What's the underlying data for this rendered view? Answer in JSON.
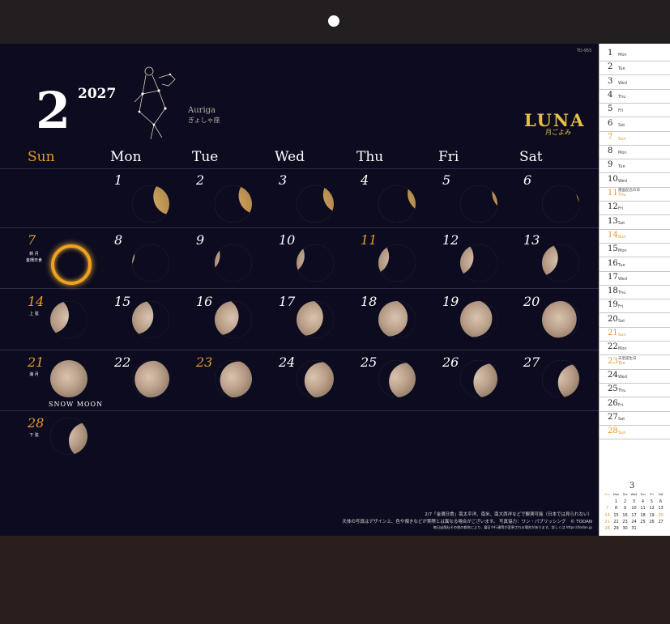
{
  "month": "2",
  "year": "2027",
  "code": "TD-955",
  "constellation": {
    "name": "Auriga",
    "jp": "ぎょしゃ座"
  },
  "brand": {
    "title": "LUNA",
    "subtitle": "月ごよみ"
  },
  "weekdays": [
    "Sun",
    "Mon",
    "Tue",
    "Wed",
    "Thu",
    "Fri",
    "Sat"
  ],
  "weeks": [
    [
      null,
      "1",
      "2",
      "3",
      "4",
      "5",
      "6"
    ],
    [
      "7",
      "8",
      "9",
      "10",
      "11",
      "12",
      "13"
    ],
    [
      "14",
      "15",
      "16",
      "17",
      "18",
      "19",
      "20"
    ],
    [
      "21",
      "22",
      "23",
      "24",
      "25",
      "26",
      "27"
    ],
    [
      "28",
      null,
      null,
      null,
      null,
      null,
      null
    ]
  ],
  "holidays": [
    "11",
    "23"
  ],
  "notes": {
    "7a": "新 月",
    "7b": "金環日食",
    "14": "上 弦",
    "21": "満 月",
    "28": "下 弦"
  },
  "snow_moon": "SNOW MOON",
  "footnote": {
    "line1": "2/7「金環日食」南太平洋、南米、南大西洋などで観測可能（日本では見られない）",
    "line2": "天体の写真はデザイン上、色や傾きなどが実際とは異なる場合がございます。 写真協力：ワン・パブリッシング　© TODAN",
    "line3": "毎日出版社その他の都合により、暦日や行事等が変更される場合があります。詳しくは https://todan.jp"
  },
  "side_list": [
    {
      "d": "1",
      "w": "Mon"
    },
    {
      "d": "2",
      "w": "Tue"
    },
    {
      "d": "3",
      "w": "Wed"
    },
    {
      "d": "4",
      "w": "Thu"
    },
    {
      "d": "5",
      "w": "Fri"
    },
    {
      "d": "6",
      "w": "Sat"
    },
    {
      "d": "7",
      "w": "Sun"
    },
    {
      "d": "8",
      "w": "Mon"
    },
    {
      "d": "9",
      "w": "Tue"
    },
    {
      "d": "10",
      "w": "Wed"
    },
    {
      "d": "11",
      "w": "Thu",
      "n": "建国記念の日"
    },
    {
      "d": "12",
      "w": "Fri"
    },
    {
      "d": "13",
      "w": "Sat"
    },
    {
      "d": "14",
      "w": "Sun"
    },
    {
      "d": "15",
      "w": "Mon"
    },
    {
      "d": "16",
      "w": "Tue"
    },
    {
      "d": "17",
      "w": "Wed"
    },
    {
      "d": "18",
      "w": "Thu"
    },
    {
      "d": "19",
      "w": "Fri"
    },
    {
      "d": "20",
      "w": "Sat"
    },
    {
      "d": "21",
      "w": "Sun"
    },
    {
      "d": "22",
      "w": "Mon"
    },
    {
      "d": "23",
      "w": "Tue",
      "n": "天皇誕生日"
    },
    {
      "d": "24",
      "w": "Wed"
    },
    {
      "d": "25",
      "w": "Thu"
    },
    {
      "d": "26",
      "w": "Fri"
    },
    {
      "d": "27",
      "w": "Sat"
    },
    {
      "d": "28",
      "w": "Sun"
    }
  ],
  "mini_calendar": {
    "month": "3",
    "weekdays": [
      "Sun",
      "Mon",
      "Tue",
      "Wed",
      "Thu",
      "Fri",
      "Sat"
    ],
    "weeks": [
      [
        null,
        "1",
        "2",
        "3",
        "4",
        "5",
        "6"
      ],
      [
        "7",
        "8",
        "9",
        "10",
        "11",
        "12",
        "13"
      ],
      [
        "14",
        "15",
        "16",
        "17",
        "18",
        "19",
        "20"
      ],
      [
        "21",
        "22",
        "23",
        "24",
        "25",
        "26",
        "27"
      ],
      [
        "28",
        "29",
        "30",
        "31",
        null,
        null,
        null
      ]
    ]
  },
  "colors": {
    "background": "#0c0b1f",
    "accent": "#e49a2c",
    "brand": "#e4c04a"
  }
}
